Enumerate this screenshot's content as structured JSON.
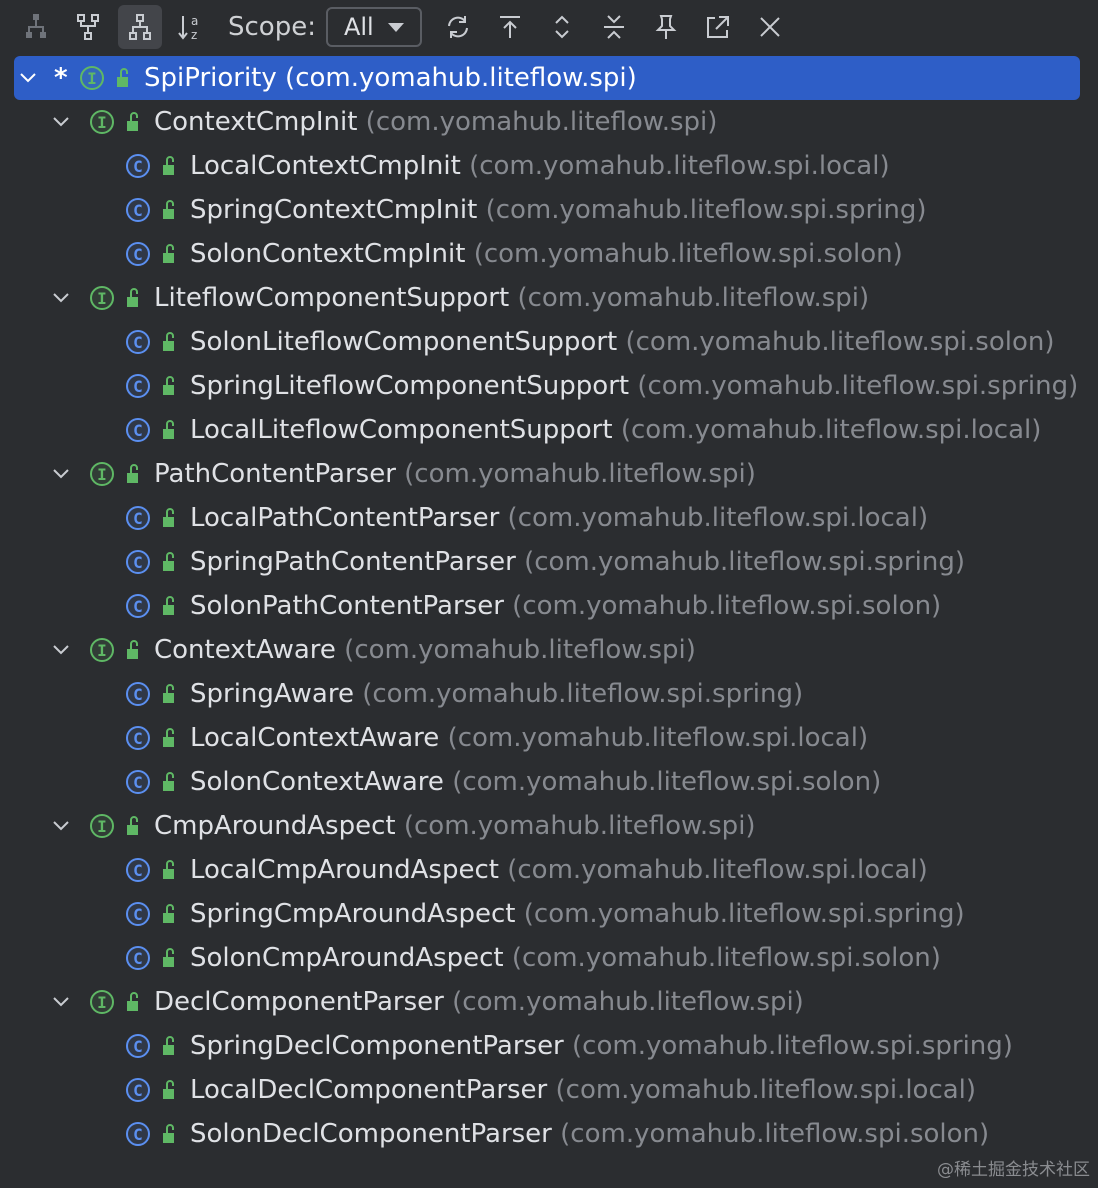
{
  "toolbar": {
    "scope_label": "Scope:",
    "scope_value": "All",
    "buttons": [
      "supertypes-hierarchy-icon",
      "subtypes-hierarchy-icon",
      "class-hierarchy-icon",
      "sort-alpha-icon",
      "refresh-icon",
      "scroll-to-source-icon",
      "expand-collapse-icon",
      "collapse-all-icon",
      "pin-icon",
      "open-in-editor-icon",
      "close-icon"
    ]
  },
  "tree": {
    "root": {
      "star": "*",
      "name": "SpiPriority",
      "pkg": "(com.yomahub.liteflow.spi)"
    },
    "groups": [
      {
        "name": "ContextCmpInit",
        "pkg": "(com.yomahub.liteflow.spi)",
        "children": [
          {
            "name": "LocalContextCmpInit",
            "pkg": "(com.yomahub.liteflow.spi.local)"
          },
          {
            "name": "SpringContextCmpInit",
            "pkg": "(com.yomahub.liteflow.spi.spring)"
          },
          {
            "name": "SolonContextCmpInit",
            "pkg": "(com.yomahub.liteflow.spi.solon)"
          }
        ]
      },
      {
        "name": "LiteflowComponentSupport",
        "pkg": "(com.yomahub.liteflow.spi)",
        "children": [
          {
            "name": "SolonLiteflowComponentSupport",
            "pkg": "(com.yomahub.liteflow.spi.solon)"
          },
          {
            "name": "SpringLiteflowComponentSupport",
            "pkg": "(com.yomahub.liteflow.spi.spring)"
          },
          {
            "name": "LocalLiteflowComponentSupport",
            "pkg": "(com.yomahub.liteflow.spi.local)"
          }
        ]
      },
      {
        "name": "PathContentParser",
        "pkg": "(com.yomahub.liteflow.spi)",
        "children": [
          {
            "name": "LocalPathContentParser",
            "pkg": "(com.yomahub.liteflow.spi.local)"
          },
          {
            "name": "SpringPathContentParser",
            "pkg": "(com.yomahub.liteflow.spi.spring)"
          },
          {
            "name": "SolonPathContentParser",
            "pkg": "(com.yomahub.liteflow.spi.solon)"
          }
        ]
      },
      {
        "name": "ContextAware",
        "pkg": "(com.yomahub.liteflow.spi)",
        "children": [
          {
            "name": "SpringAware",
            "pkg": "(com.yomahub.liteflow.spi.spring)"
          },
          {
            "name": "LocalContextAware",
            "pkg": "(com.yomahub.liteflow.spi.local)"
          },
          {
            "name": "SolonContextAware",
            "pkg": "(com.yomahub.liteflow.spi.solon)"
          }
        ]
      },
      {
        "name": "CmpAroundAspect",
        "pkg": "(com.yomahub.liteflow.spi)",
        "children": [
          {
            "name": "LocalCmpAroundAspect",
            "pkg": "(com.yomahub.liteflow.spi.local)"
          },
          {
            "name": "SpringCmpAroundAspect",
            "pkg": "(com.yomahub.liteflow.spi.spring)"
          },
          {
            "name": "SolonCmpAroundAspect",
            "pkg": "(com.yomahub.liteflow.spi.solon)"
          }
        ]
      },
      {
        "name": "DeclComponentParser",
        "pkg": "(com.yomahub.liteflow.spi)",
        "children": [
          {
            "name": "SpringDeclComponentParser",
            "pkg": "(com.yomahub.liteflow.spi.spring)"
          },
          {
            "name": "LocalDeclComponentParser",
            "pkg": "(com.yomahub.liteflow.spi.local)"
          },
          {
            "name": "SolonDeclComponentParser",
            "pkg": "(com.yomahub.liteflow.spi.solon)"
          }
        ]
      }
    ]
  },
  "icons": {
    "interface_letter": "I",
    "class_letter": "C"
  },
  "watermark": "@稀土掘金技术社区",
  "colors": {
    "background": "#2b2d30",
    "selection": "#2e5ec7",
    "interface": "#5fb865",
    "class": "#5b8ff0",
    "lock": "#5fb865",
    "package_text": "#878a90"
  }
}
